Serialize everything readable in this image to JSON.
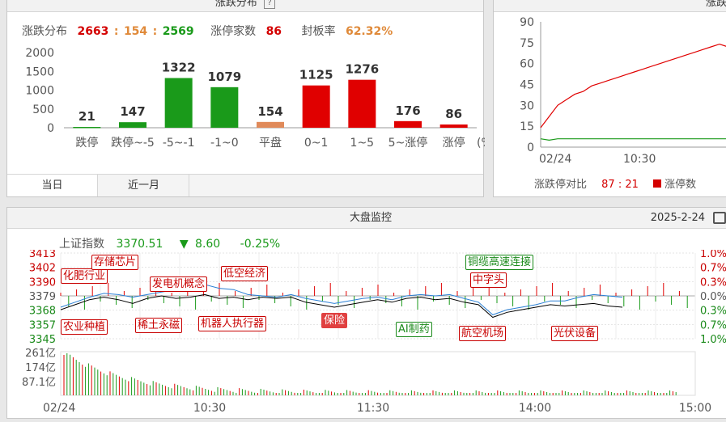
{
  "dist_panel": {
    "title": "涨跌分布",
    "help": "?",
    "stats": {
      "dist_label": "涨跌分布",
      "up": "2663",
      "flat": "154",
      "down": "2569",
      "sep": ":",
      "limit_label": "涨停家数",
      "limit_count": "86",
      "seal_label": "封板率",
      "seal_rate": "62.32%"
    },
    "tabs": [
      "当日",
      "近一月"
    ]
  },
  "chart_data": [
    {
      "type": "bar",
      "categories": [
        "跌停",
        "跌停~-5",
        "-5~-1",
        "-1~0",
        "平盘",
        "0~1",
        "1~5",
        "5~涨停",
        "涨停"
      ],
      "values": [
        21,
        147,
        1322,
        1079,
        154,
        1125,
        1276,
        176,
        86
      ],
      "colors": [
        "#1a9a1a",
        "#1a9a1a",
        "#1a9a1a",
        "#1a9a1a",
        "#e08a5a",
        "#e00000",
        "#e00000",
        "#e00000",
        "#e00000"
      ],
      "y_ticks": [
        "2000",
        "1500",
        "1000",
        "500",
        "0"
      ],
      "ylim": [
        0,
        2000
      ],
      "unit": "(%)"
    },
    {
      "type": "line",
      "x_ticks": [
        "02/24",
        "10:30"
      ],
      "y_ticks": [
        "90",
        "75",
        "60",
        "45",
        "30",
        "15",
        "0"
      ],
      "ylim": [
        0,
        90
      ],
      "series": [
        {
          "color": "#e00000",
          "values": [
            14,
            22,
            30,
            34,
            38,
            40,
            44,
            46,
            48,
            50,
            52,
            54,
            56,
            58,
            60,
            62,
            64,
            66,
            68,
            70,
            72,
            74,
            72,
            70
          ]
        },
        {
          "color": "#1a9a1a",
          "values": [
            6,
            5,
            6,
            6,
            6,
            6,
            6,
            6,
            6,
            6,
            6,
            6,
            6,
            6,
            6,
            6,
            6,
            6,
            6,
            6,
            6,
            6,
            6,
            6
          ]
        }
      ]
    },
    {
      "type": "line",
      "x_ticks": [
        "02/24",
        "10:30",
        "11:30",
        "14:00",
        "15:00"
      ],
      "y_ticks_left": [
        "3413",
        "3402",
        "3390",
        "3379",
        "3368",
        "3357",
        "3345"
      ],
      "y_ticks_right": [
        "1.0%",
        "0.7%",
        "0.3%",
        "0.0%",
        "0.3%",
        "0.7%",
        "1.0%"
      ],
      "ylim": [
        3345,
        3413
      ],
      "series": [
        {
          "color": "#000000",
          "values": [
            3368,
            3372,
            3376,
            3378,
            3376,
            3373,
            3377,
            3379,
            3377,
            3378,
            3380,
            3377,
            3378,
            3376,
            3378,
            3377,
            3378,
            3374,
            3372,
            3370,
            3372,
            3374,
            3376,
            3374,
            3377,
            3378,
            3376,
            3377,
            3374,
            3372,
            3362,
            3366,
            3368,
            3370,
            3372,
            3371,
            3372,
            3373,
            3371,
            3370
          ]
        },
        {
          "color": "#2a7fd4",
          "values": [
            3370,
            3374,
            3378,
            3381,
            3380,
            3378,
            3380,
            3382,
            3384,
            3386,
            3388,
            3385,
            3384,
            3380,
            3379,
            3378,
            3380,
            3377,
            3375,
            3373,
            3375,
            3377,
            3378,
            3376,
            3379,
            3380,
            3379,
            3380,
            3377,
            3374,
            3364,
            3368,
            3370,
            3372,
            3375,
            3375,
            3378,
            3380,
            3379,
            3378
          ]
        }
      ]
    }
  ],
  "ratio_panel": {
    "title": "涨跌",
    "ratio_label": "涨跌停对比",
    "ratio_value": "87 : 21",
    "legend_label": "涨停数"
  },
  "monitor_panel": {
    "title": "大盘监控",
    "date": "2025-2-24",
    "index_name": "上证指数",
    "index_value": "3370.51",
    "change_arrow": "▼",
    "change": "8.60",
    "change_pct": "-0.25%",
    "vol_ticks": [
      "261亿",
      "174亿",
      "87.1亿"
    ],
    "tags": [
      {
        "text": "化肥行业",
        "kind": "r"
      },
      {
        "text": "存储芯片",
        "kind": "r"
      },
      {
        "text": "发电机概念",
        "kind": "r"
      },
      {
        "text": "低空经济",
        "kind": "r"
      },
      {
        "text": "农业种植",
        "kind": "r"
      },
      {
        "text": "稀土永磁",
        "kind": "r"
      },
      {
        "text": "机器人执行器",
        "kind": "r"
      },
      {
        "text": "保险",
        "kind": "rf"
      },
      {
        "text": "AI制药",
        "kind": "g"
      },
      {
        "text": "铜缆高速连接",
        "kind": "g"
      },
      {
        "text": "中字头",
        "kind": "r"
      },
      {
        "text": "航空机场",
        "kind": "r"
      },
      {
        "text": "光伏设备",
        "kind": "r"
      }
    ]
  }
}
